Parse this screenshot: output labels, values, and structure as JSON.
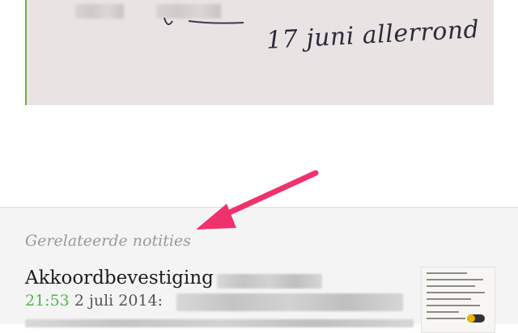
{
  "note_image": {
    "handwriting_text": "17 juni allerrond"
  },
  "related": {
    "title": "Gerelateerde notities",
    "notes": [
      {
        "title": "Akkoordbevestiging",
        "time": "21:53",
        "date": "2 juli 2014:"
      }
    ]
  },
  "colors": {
    "accent_green": "#4fb848",
    "arrow": "#f0326c",
    "paper": "#e9e4e3"
  }
}
